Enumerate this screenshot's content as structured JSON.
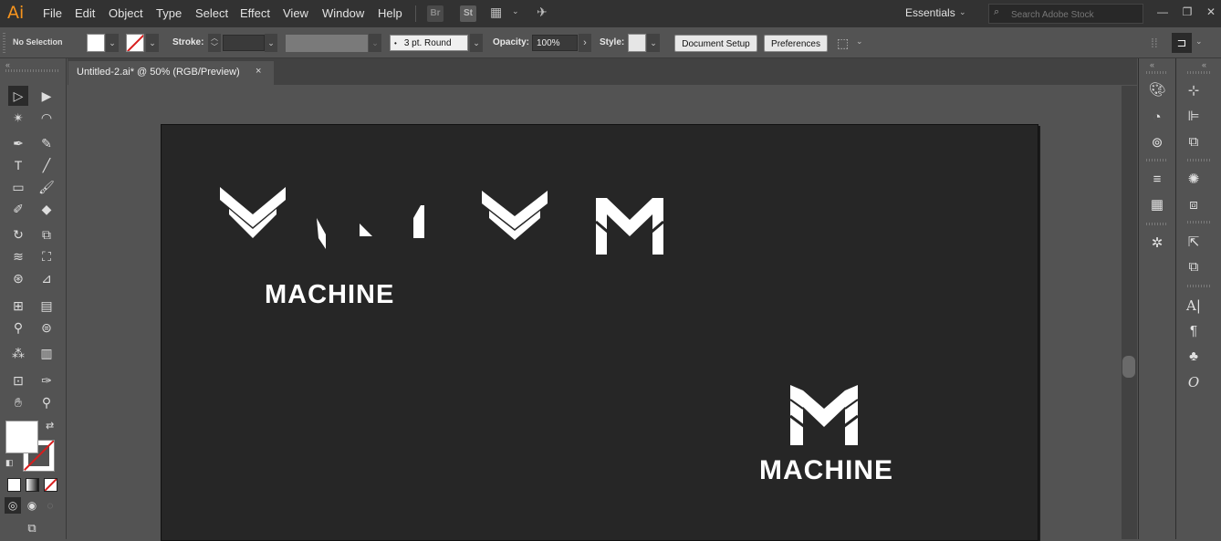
{
  "app": {
    "logo": "Ai"
  },
  "menu": [
    "File",
    "Edit",
    "Object",
    "Type",
    "Select",
    "Effect",
    "View",
    "Window",
    "Help"
  ],
  "menubar_icons": {
    "bridge": "Br",
    "stock": "St"
  },
  "workspace": {
    "label": "Essentials"
  },
  "search": {
    "placeholder": "Search Adobe Stock"
  },
  "control": {
    "selection": "No Selection",
    "stroke_label": "Stroke:",
    "brush_value": "3 pt. Round",
    "opacity_label": "Opacity:",
    "opacity_value": "100%",
    "style_label": "Style:",
    "document_setup": "Document Setup",
    "preferences": "Preferences"
  },
  "document_tab": {
    "title": "Untitled-2.ai* @ 50% (RGB/Preview)",
    "close": "×"
  },
  "artwork": {
    "wordmark_top": "MACHINE",
    "wordmark_bottom": "MACHINE",
    "color": "#ffffff",
    "artboard_color": "#262626"
  },
  "colors": {
    "logo": "#f7941d",
    "stroke_none": "#d81e1e"
  }
}
